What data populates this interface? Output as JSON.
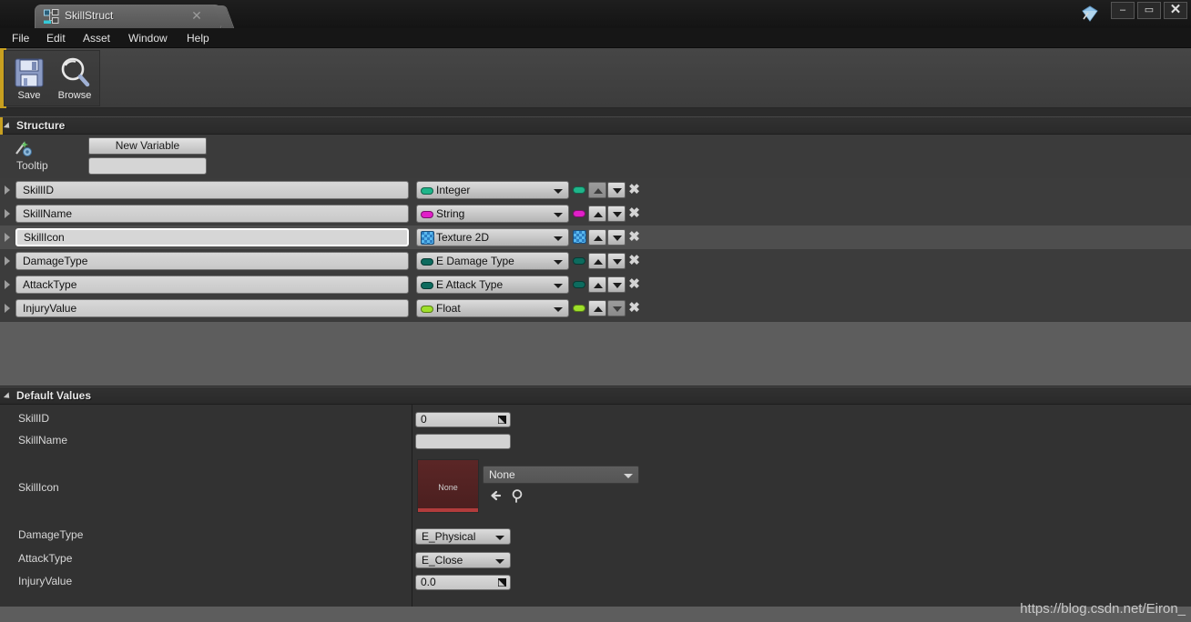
{
  "window": {
    "tab_title": "SkillStruct",
    "tab_icon": "blueprint-struct-icon",
    "close_icon": "close-icon",
    "logo_icon": "unreal-logo-icon",
    "gem_icon": "gem-diamond-icon",
    "minimize_label": "–",
    "maximize_label": "▭",
    "close_label": "✕"
  },
  "menu": [
    {
      "label": "File"
    },
    {
      "label": "Edit"
    },
    {
      "label": "Asset"
    },
    {
      "label": "Window"
    },
    {
      "label": "Help"
    }
  ],
  "toolbar": {
    "buttons": [
      {
        "label": "Save",
        "icon": "floppy-disk-icon"
      },
      {
        "label": "Browse",
        "icon": "magnifier-icon"
      }
    ]
  },
  "structure": {
    "title": "Structure",
    "new_variable_label": "New Variable",
    "magic_icon": "magic-wand-gear-icon",
    "tooltip_label": "Tooltip",
    "tooltip_value": "",
    "variables": [
      {
        "name": "SkillID",
        "type": "Integer",
        "pill": "#1fb58a",
        "selected": false,
        "up_disabled": true,
        "down_disabled": false
      },
      {
        "name": "SkillName",
        "type": "String",
        "pill": "#e11fc8",
        "selected": false,
        "up_disabled": false,
        "down_disabled": false
      },
      {
        "name": "SkillIcon",
        "type": "Texture 2D",
        "pill": "texture",
        "selected": true,
        "up_disabled": false,
        "down_disabled": false
      },
      {
        "name": "DamageType",
        "type": "E Damage Type",
        "pill": "#0d6b5e",
        "selected": false,
        "up_disabled": false,
        "down_disabled": false
      },
      {
        "name": "AttackType",
        "type": "E Attack Type",
        "pill": "#0d6b5e",
        "selected": false,
        "up_disabled": false,
        "down_disabled": false
      },
      {
        "name": "InjuryValue",
        "type": "Float",
        "pill": "#9ee02a",
        "selected": false,
        "up_disabled": false,
        "down_disabled": true
      }
    ]
  },
  "defaults": {
    "title": "Default Values",
    "fields": [
      {
        "label": "SkillID",
        "kind": "number",
        "value": "0"
      },
      {
        "label": "SkillName",
        "kind": "text",
        "value": ""
      },
      {
        "label": "SkillIcon",
        "kind": "asset",
        "value": "None",
        "thumb_label": "None"
      },
      {
        "label": "DamageType",
        "kind": "enum",
        "value": "E_Physical"
      },
      {
        "label": "AttackType",
        "kind": "enum",
        "value": "E_Close"
      },
      {
        "label": "InjuryValue",
        "kind": "number",
        "value": "0.0"
      }
    ],
    "asset_back_icon": "arrow-left-icon",
    "asset_browse_icon": "magnifier-icon"
  },
  "watermark": "https://blog.csdn.net/Eiron_"
}
